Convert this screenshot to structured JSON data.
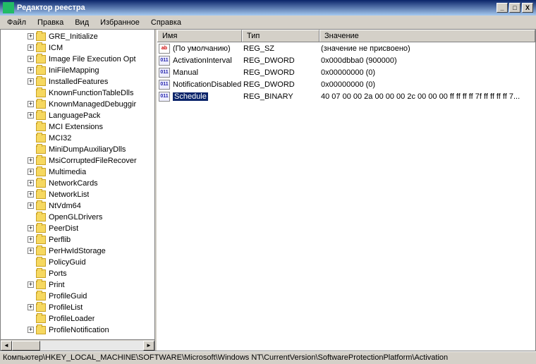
{
  "title": "Редактор реестра",
  "menu": [
    "Файл",
    "Правка",
    "Вид",
    "Избранное",
    "Справка"
  ],
  "winbtns": {
    "min": "_",
    "max": "□",
    "close": "X"
  },
  "tree": [
    {
      "label": "GRE_Initialize",
      "exp": "+"
    },
    {
      "label": "ICM",
      "exp": "+"
    },
    {
      "label": "Image File Execution Opt",
      "exp": "+"
    },
    {
      "label": "IniFileMapping",
      "exp": "+"
    },
    {
      "label": "InstalledFeatures",
      "exp": "+"
    },
    {
      "label": "KnownFunctionTableDlls",
      "exp": ""
    },
    {
      "label": "KnownManagedDebuggir",
      "exp": "+"
    },
    {
      "label": "LanguagePack",
      "exp": "+"
    },
    {
      "label": "MCI Extensions",
      "exp": ""
    },
    {
      "label": "MCI32",
      "exp": ""
    },
    {
      "label": "MiniDumpAuxiliaryDlls",
      "exp": ""
    },
    {
      "label": "MsiCorruptedFileRecover",
      "exp": "+"
    },
    {
      "label": "Multimedia",
      "exp": "+"
    },
    {
      "label": "NetworkCards",
      "exp": "+"
    },
    {
      "label": "NetworkList",
      "exp": "+"
    },
    {
      "label": "NtVdm64",
      "exp": "+"
    },
    {
      "label": "OpenGLDrivers",
      "exp": ""
    },
    {
      "label": "PeerDist",
      "exp": "+"
    },
    {
      "label": "Perflib",
      "exp": "+"
    },
    {
      "label": "PerHwIdStorage",
      "exp": "+"
    },
    {
      "label": "PolicyGuid",
      "exp": ""
    },
    {
      "label": "Ports",
      "exp": ""
    },
    {
      "label": "Print",
      "exp": "+"
    },
    {
      "label": "ProfileGuid",
      "exp": ""
    },
    {
      "label": "ProfileList",
      "exp": "+"
    },
    {
      "label": "ProfileLoader",
      "exp": ""
    },
    {
      "label": "ProfileNotification",
      "exp": "+"
    }
  ],
  "columns": {
    "name": "Имя",
    "type": "Тип",
    "value": "Значение"
  },
  "values": [
    {
      "icon": "sz",
      "name": "(По умолчанию)",
      "type": "REG_SZ",
      "value": "(значение не присвоено)",
      "selected": false
    },
    {
      "icon": "bin",
      "name": "ActivationInterval",
      "type": "REG_DWORD",
      "value": "0x000dbba0 (900000)",
      "selected": false
    },
    {
      "icon": "bin",
      "name": "Manual",
      "type": "REG_DWORD",
      "value": "0x00000000 (0)",
      "selected": false
    },
    {
      "icon": "bin",
      "name": "NotificationDisabled",
      "type": "REG_DWORD",
      "value": "0x00000000 (0)",
      "selected": false
    },
    {
      "icon": "bin",
      "name": "Schedule",
      "type": "REG_BINARY",
      "value": "40 07 00 00 2a 00 00 00 2c 00 00 00 ff ff ff ff 7f ff ff ff ff 7...",
      "selected": true
    }
  ],
  "iconText": {
    "sz": "ab",
    "bin": "011"
  },
  "status": "Компьютер\\HKEY_LOCAL_MACHINE\\SOFTWARE\\Microsoft\\Windows NT\\CurrentVersion\\SoftwareProtectionPlatform\\Activation",
  "scroll": {
    "left": "◄",
    "right": "►"
  }
}
